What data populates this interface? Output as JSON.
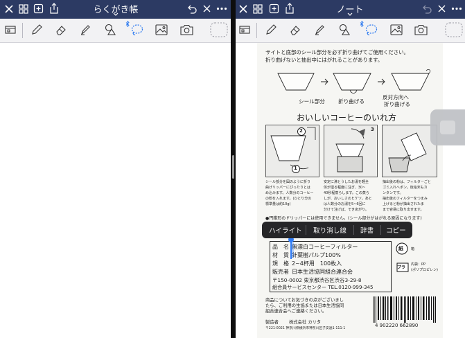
{
  "left": {
    "title": "らくがき帳"
  },
  "right": {
    "title": "ノート"
  },
  "popup": {
    "items": [
      "ハイライト",
      "取り消し線",
      "辞書",
      "コピー"
    ]
  },
  "doc": {
    "instruction": [
      "サイトと底部のシール部分を必ず折り曲げてご使用ください。",
      "折り曲げないと抽出中にはがれることがあります。"
    ],
    "fold_labels": [
      "シール部分",
      "折り曲げる",
      "反対方向へ",
      "折り曲げる"
    ],
    "heading": "おいしいコーヒーのいれ方",
    "step_numbers": [
      "2",
      "1",
      "3"
    ],
    "col1": [
      "シール部分を図のように折り",
      "曲げリッパーにぴったりとは",
      "め込みます。人数分のコーヒー",
      "の粉を入れます。(ひとり分の",
      "標準量は約10g)"
    ],
    "col2": [
      "安定に沸とうしたお湯を軽全",
      "体が湿る程度に注ぎ、30~",
      "40秒程蒸らします。この蒸ら",
      "しが、おいしさのヒケツ。あと",
      "は人数分のお湯を5~6回に",
      "分けて注げば、できあがり。"
    ],
    "col3": [
      "抽出後の粉は、フィルターごと",
      "ゴミ入れへポン。後始末もカ",
      "ンタンです。",
      "抽出後のフィルターをつまみ",
      "上げると粉が抽出されたま",
      "まで容易に取り出せます。"
    ],
    "note": "●円錐形のドリッパーには使用できません。(シール部分がはがれる原因になります)",
    "spec_rows": [
      {
        "label": "品　名",
        "value": "無漂白コーヒーフィルター"
      },
      {
        "label": "材　質",
        "value": "針葉樹パルプ100%"
      },
      {
        "label": "規　格",
        "value": "2~4杯用　100枚入"
      },
      {
        "label": "販売者",
        "value": "日本生活協同組合連合会"
      },
      {
        "label": "",
        "value": "〒150-0002 東京都渋谷区渋谷3-29-8"
      },
      {
        "label": "",
        "value": "組合員サービスセンター TEL.0120-999-345"
      }
    ],
    "recycle": {
      "paper": "紙",
      "paper_note": "箱",
      "pla": "プラ",
      "pla_note1": "内袋：PP",
      "pla_note2": "(ポリプロピレン)"
    },
    "contact": [
      "商品についてお気づきの点がございまし",
      "たら、ご利用の生協または日本生活協同",
      "組合連合会へご連絡ください。"
    ],
    "maker": {
      "label": "製造者",
      "name": "株式会社 カリタ",
      "address": "〒221-0021 神奈川県横浜市神奈川区子安通1-111-1"
    },
    "barcode_number": "4 902220 662890"
  }
}
